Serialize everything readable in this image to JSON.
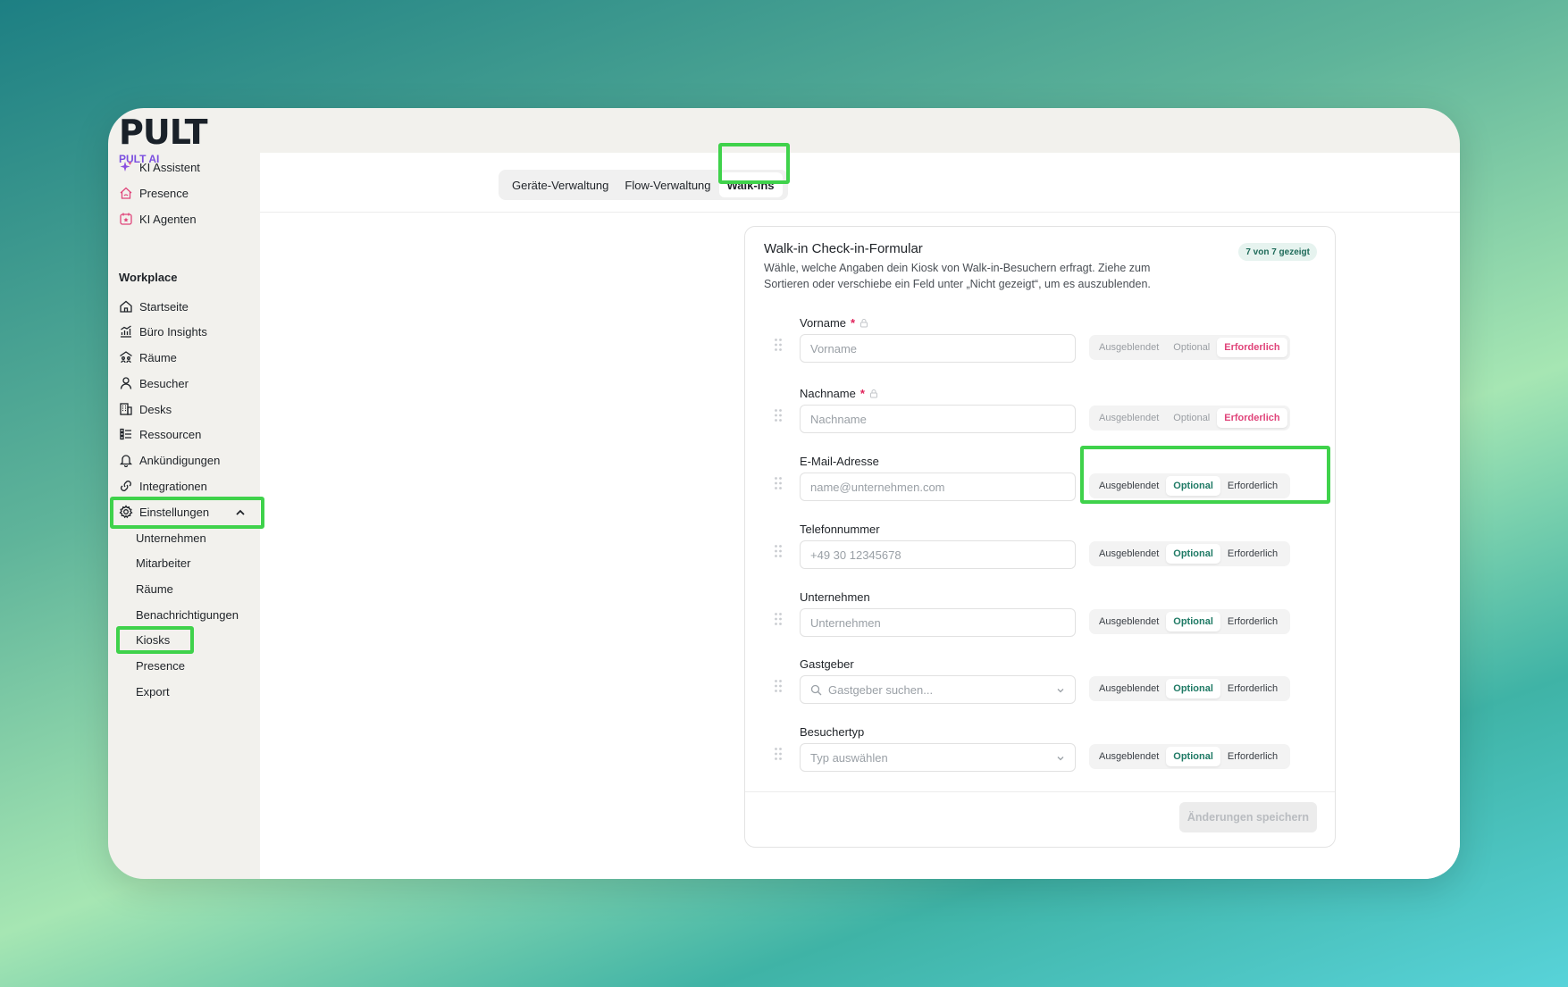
{
  "brand": {
    "logo": "PULT",
    "ai_section": "PULT AI"
  },
  "sidebar": {
    "ai_items": [
      {
        "label": "KI Assistent",
        "icon": "sparkle-icon"
      },
      {
        "label": "Presence",
        "icon": "home-wifi-icon"
      },
      {
        "label": "KI Agenten",
        "icon": "calendar-star-icon"
      }
    ],
    "workplace_title": "Workplace",
    "items": [
      {
        "label": "Startseite",
        "icon": "home-icon"
      },
      {
        "label": "Büro Insights",
        "icon": "chart-icon"
      },
      {
        "label": "Räume",
        "icon": "rooms-icon"
      },
      {
        "label": "Besucher",
        "icon": "user-icon"
      },
      {
        "label": "Desks",
        "icon": "building-icon"
      },
      {
        "label": "Ressourcen",
        "icon": "list-icon"
      },
      {
        "label": "Ankündigungen",
        "icon": "bell-icon"
      },
      {
        "label": "Integrationen",
        "icon": "link-icon"
      },
      {
        "label": "Einstellungen",
        "icon": "gear-icon"
      }
    ],
    "settings_sub": [
      "Unternehmen",
      "Mitarbeiter",
      "Räume",
      "Benachrichtigungen",
      "Kiosks",
      "Presence",
      "Export"
    ]
  },
  "tabs": [
    "Geräte-Verwaltung",
    "Flow-Verwaltung",
    "Walk-ins"
  ],
  "form": {
    "title": "Walk-in Check-in-Formular",
    "description": "Wähle, welche Angaben dein Kiosk von Walk-in-Besuchern erfragt. Ziehe zum Sortieren oder verschiebe ein Feld unter „Nicht gezeigt“, um es auszublenden.",
    "badge": "7 von 7 gezeigt",
    "segment_labels": [
      "Ausgeblendet",
      "Optional",
      "Erforderlich"
    ],
    "fields": [
      {
        "label": "Vorname",
        "required_mark": "*",
        "placeholder": "Vorname",
        "mode": "Erforderlich"
      },
      {
        "label": "Nachname",
        "required_mark": "*",
        "placeholder": "Nachname",
        "mode": "Erforderlich"
      },
      {
        "label": "E-Mail-Adresse",
        "placeholder": "name@unternehmen.com",
        "mode": "Optional"
      },
      {
        "label": "Telefonnummer",
        "placeholder": "+49 30 12345678",
        "mode": "Optional"
      },
      {
        "label": "Unternehmen",
        "placeholder": "Unternehmen",
        "mode": "Optional"
      },
      {
        "label": "Gastgeber",
        "placeholder": "Gastgeber suchen...",
        "mode": "Optional"
      },
      {
        "label": "Besuchertyp",
        "placeholder": "Typ auswählen",
        "mode": "Optional"
      }
    ],
    "save_label": "Änderungen speichern"
  },
  "colors": {
    "accent_green": "#1f7a65",
    "required_pink": "#e0447a",
    "highlight": "#3fd24b",
    "ai_purple": "#7b4fe0"
  }
}
